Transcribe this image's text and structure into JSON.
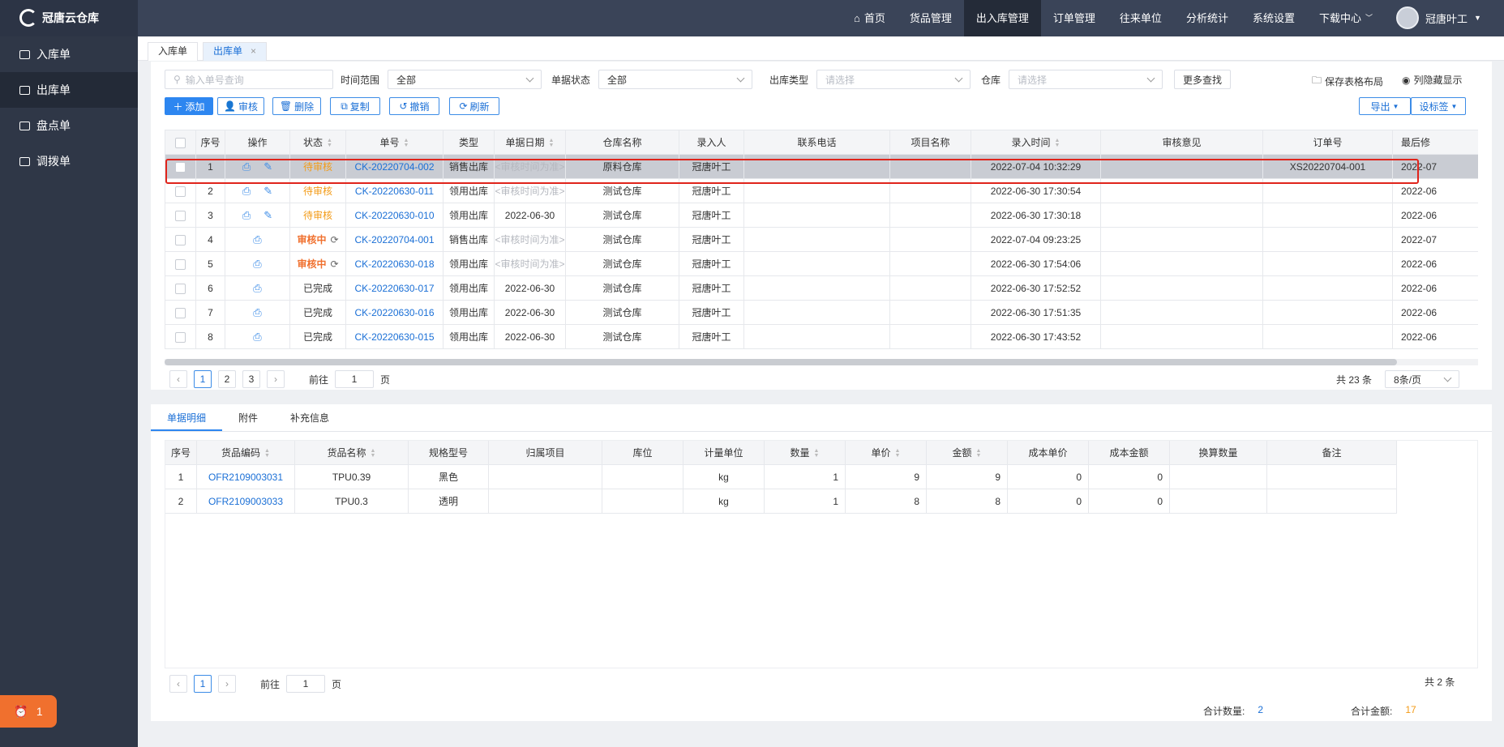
{
  "app": {
    "name": "冠唐云仓库",
    "user": "冠唐叶工"
  },
  "topnav": [
    {
      "label": "首页",
      "icon": "home-icon"
    },
    {
      "label": "货品管理"
    },
    {
      "label": "出入库管理",
      "active": true
    },
    {
      "label": "订单管理"
    },
    {
      "label": "往来单位"
    },
    {
      "label": "分析统计"
    },
    {
      "label": "系统设置"
    },
    {
      "label": "下载中心",
      "dropdown": true
    }
  ],
  "sidebar": [
    {
      "label": "入库单",
      "icon": "folder-icon"
    },
    {
      "label": "出库单",
      "icon": "folder-icon",
      "active": true
    },
    {
      "label": "盘点单",
      "icon": "folder-icon"
    },
    {
      "label": "调拨单",
      "icon": "folder-icon"
    }
  ],
  "alert": {
    "count": "1"
  },
  "tabs": [
    {
      "label": "入库单"
    },
    {
      "label": "出库单",
      "active": true
    }
  ],
  "filters": {
    "search_placeholder": "输入单号查询",
    "time_label": "时间范围",
    "time_value": "全部",
    "status_label": "单据状态",
    "status_value": "全部",
    "type_label": "出库类型",
    "type_placeholder": "请选择",
    "warehouse_label": "仓库",
    "warehouse_placeholder": "请选择",
    "more": "更多查找",
    "save_layout": "保存表格布局",
    "hide_cols": "列隐藏显示"
  },
  "toolbar": {
    "add": "添加",
    "audit": "审核",
    "delete": "删除",
    "copy": "复制",
    "revoke": "撤销",
    "refresh": "刷新",
    "export": "导出",
    "set_tag": "设标签"
  },
  "table": {
    "headers": [
      "序号",
      "操作",
      "状态",
      "单号",
      "类型",
      "单据日期",
      "仓库名称",
      "录入人",
      "联系电话",
      "项目名称",
      "录入时间",
      "审核意见",
      "订单号",
      "最后修"
    ],
    "rows": [
      {
        "no": "1",
        "ops": "print-edit",
        "status": "待审核",
        "status_type": "wait",
        "code": "CK-20220704-002",
        "type": "销售出库",
        "date": "<审核时间为准>",
        "warehouse": "原料仓库",
        "creator": "冠唐叶工",
        "phone": "",
        "project": "",
        "created": "2022-07-04 10:32:29",
        "comment": "",
        "order": "XS20220704-001",
        "last": "2022-07"
      },
      {
        "no": "2",
        "ops": "print-edit",
        "status": "待审核",
        "status_type": "wait",
        "code": "CK-20220630-011",
        "type": "领用出库",
        "date": "<审核时间为准>",
        "warehouse": "测试仓库",
        "creator": "冠唐叶工",
        "phone": "",
        "project": "",
        "created": "2022-06-30 17:30:54",
        "comment": "",
        "order": "",
        "last": "2022-06"
      },
      {
        "no": "3",
        "ops": "print-edit",
        "status": "待审核",
        "status_type": "wait",
        "code": "CK-20220630-010",
        "type": "领用出库",
        "date": "2022-06-30",
        "warehouse": "测试仓库",
        "creator": "冠唐叶工",
        "phone": "",
        "project": "",
        "created": "2022-06-30 17:30:18",
        "comment": "",
        "order": "",
        "last": "2022-06"
      },
      {
        "no": "4",
        "ops": "print",
        "status": "审核中",
        "status_type": "proc",
        "code": "CK-20220704-001",
        "type": "销售出库",
        "date": "<审核时间为准>",
        "warehouse": "测试仓库",
        "creator": "冠唐叶工",
        "phone": "",
        "project": "",
        "created": "2022-07-04 09:23:25",
        "comment": "",
        "order": "",
        "last": "2022-07"
      },
      {
        "no": "5",
        "ops": "print",
        "status": "审核中",
        "status_type": "proc",
        "code": "CK-20220630-018",
        "type": "领用出库",
        "date": "<审核时间为准>",
        "warehouse": "测试仓库",
        "creator": "冠唐叶工",
        "phone": "",
        "project": "",
        "created": "2022-06-30 17:54:06",
        "comment": "",
        "order": "",
        "last": "2022-06"
      },
      {
        "no": "6",
        "ops": "print",
        "status": "已完成",
        "status_type": "done",
        "code": "CK-20220630-017",
        "type": "领用出库",
        "date": "2022-06-30",
        "warehouse": "测试仓库",
        "creator": "冠唐叶工",
        "phone": "",
        "project": "",
        "created": "2022-06-30 17:52:52",
        "comment": "",
        "order": "",
        "last": "2022-06"
      },
      {
        "no": "7",
        "ops": "print",
        "status": "已完成",
        "status_type": "done",
        "code": "CK-20220630-016",
        "type": "领用出库",
        "date": "2022-06-30",
        "warehouse": "测试仓库",
        "creator": "冠唐叶工",
        "phone": "",
        "project": "",
        "created": "2022-06-30 17:51:35",
        "comment": "",
        "order": "",
        "last": "2022-06"
      },
      {
        "no": "8",
        "ops": "print",
        "status": "已完成",
        "status_type": "done",
        "code": "CK-20220630-015",
        "type": "领用出库",
        "date": "2022-06-30",
        "warehouse": "测试仓库",
        "creator": "冠唐叶工",
        "phone": "",
        "project": "",
        "created": "2022-06-30 17:43:52",
        "comment": "",
        "order": "",
        "last": "2022-06"
      }
    ]
  },
  "pager": {
    "pages": [
      "1",
      "2",
      "3"
    ],
    "goto_prefix": "前往",
    "goto_value": "1",
    "goto_suffix": "页",
    "total": "共 23 条",
    "page_size": "8条/页"
  },
  "detail": {
    "tabs": [
      "单据明细",
      "附件",
      "补充信息"
    ],
    "headers": [
      "序号",
      "货品编码",
      "货品名称",
      "规格型号",
      "归属项目",
      "库位",
      "计量单位",
      "数量",
      "单价",
      "金额",
      "成本单价",
      "成本金额",
      "换算数量",
      "备注"
    ],
    "rows": [
      {
        "no": "1",
        "code": "OFR2109003031",
        "name": "TPU0.39",
        "spec": "黑色",
        "project": "",
        "loc": "",
        "unit": "kg",
        "qty": "1",
        "price": "9",
        "amount": "9",
        "cost_price": "0",
        "cost_amount": "0",
        "conv": "",
        "remark": ""
      },
      {
        "no": "2",
        "code": "OFR2109003033",
        "name": "TPU0.3",
        "spec": "透明",
        "project": "",
        "loc": "",
        "unit": "kg",
        "qty": "1",
        "price": "8",
        "amount": "8",
        "cost_price": "0",
        "cost_amount": "0",
        "conv": "",
        "remark": ""
      }
    ],
    "pager": {
      "page": "1",
      "goto_prefix": "前往",
      "goto_value": "1",
      "goto_suffix": "页",
      "total": "共 2 条"
    },
    "summary": {
      "qty_label": "合计数量:",
      "qty": "2",
      "amount_label": "合计金额:",
      "amount": "17"
    }
  },
  "colors": {
    "topbar": "#3a4458",
    "sidebar": "#2f3747",
    "accent": "#2d86f0",
    "wait": "#f39b17",
    "proc": "#f0702e",
    "highlight": "#e0241b"
  }
}
